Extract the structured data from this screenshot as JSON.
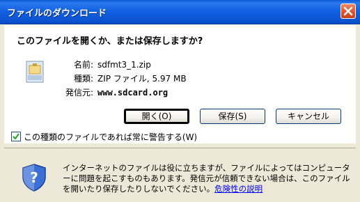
{
  "window": {
    "title": "ファイルのダウンロード",
    "close_icon": "close-icon"
  },
  "prompt": {
    "question": "このファイルを開くか、または保存しますか?"
  },
  "file": {
    "icon": "zip-file-icon",
    "name_label": "名前:",
    "name_value": "sdfmt3_1.zip",
    "type_label": "種類:",
    "type_value": "ZIP ファイル, 5.97 MB",
    "source_label": "発信元:",
    "source_value": "www.sdcard.org"
  },
  "buttons": {
    "open": "開く(O)",
    "save": "保存(S)",
    "cancel": "キャンセル"
  },
  "checkbox": {
    "checked": true,
    "label": "この種類のファイルであれば常に警告する(W)"
  },
  "warning": {
    "icon": "shield-question-icon",
    "text": "インターネットのファイルは役に立ちますが、ファイルによってはコンピューターに問題を起こすものもあります。発信元が信頼できない場合は、このファイルを開いたり保存したりしないでください。",
    "link": "危険性の説明"
  },
  "colors": {
    "titlebar": "#0b54d2",
    "dialog_bg": "#ece9d8",
    "close_button": "#e2562f",
    "link": "#0000ff"
  }
}
